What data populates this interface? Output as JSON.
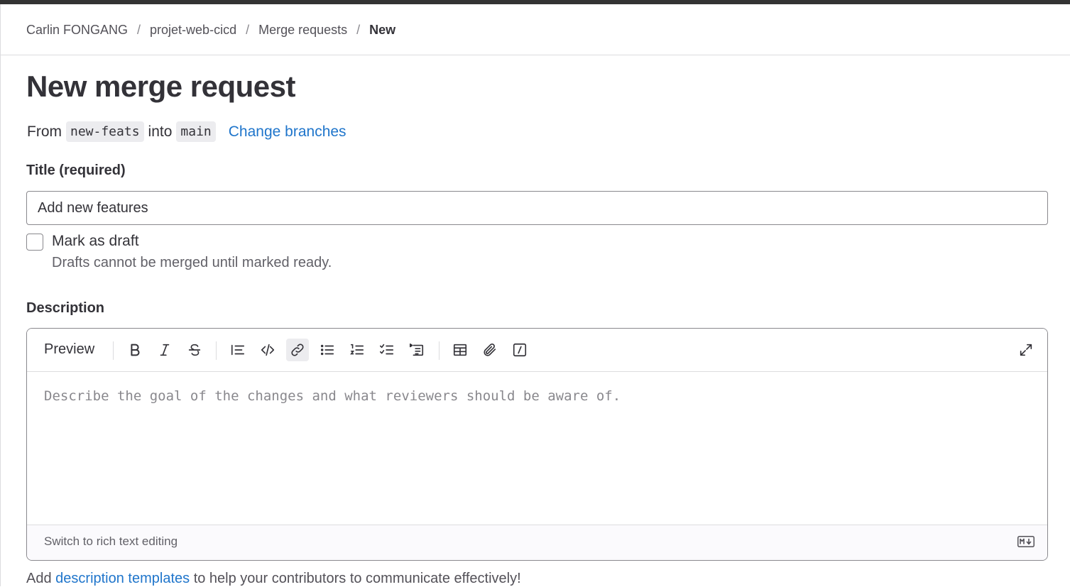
{
  "breadcrumb": {
    "items": [
      "Carlin FONGANG",
      "projet-web-cicd",
      "Merge requests"
    ],
    "current": "New",
    "separator": "/"
  },
  "page": {
    "title": "New merge request"
  },
  "branches": {
    "from_label": "From",
    "source": "new-feats",
    "into_label": "into",
    "target": "main",
    "change_link": "Change branches"
  },
  "form": {
    "title_label": "Title (required)",
    "title_value": "Add new features",
    "draft_label": "Mark as draft",
    "draft_checked": false,
    "draft_help": "Drafts cannot be merged until marked ready.",
    "description_label": "Description"
  },
  "editor": {
    "preview_label": "Preview",
    "toolbar_icons": [
      "bold-icon",
      "italic-icon",
      "strikethrough-icon",
      "quote-icon",
      "code-icon",
      "link-icon",
      "bullet-list-icon",
      "numbered-list-icon",
      "task-list-icon",
      "collapsible-section-icon",
      "table-icon",
      "attach-file-icon",
      "quick-actions-icon",
      "fullscreen-icon"
    ],
    "placeholder": "Describe the goal of the changes and what reviewers should be aware of.",
    "switch_label": "Switch to rich text editing",
    "markdown_icon": "markdown-icon"
  },
  "templates_note": {
    "prefix": "Add ",
    "link": "description templates",
    "suffix": " to help your contributors to communicate effectively!"
  },
  "colors": {
    "link": "#1f75cb",
    "text": "#333238",
    "muted": "#626168",
    "border": "#89888d"
  }
}
